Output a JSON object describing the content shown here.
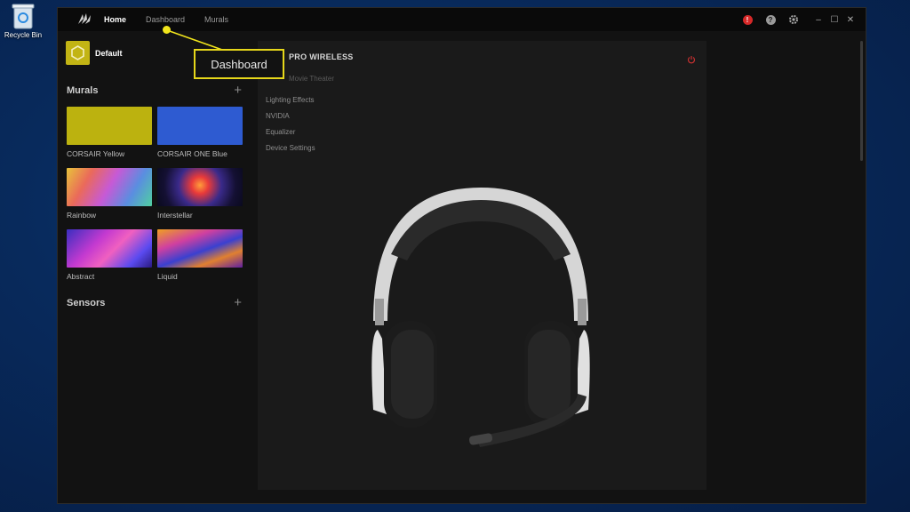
{
  "desktop": {
    "recycle_bin_label": "Recycle Bin"
  },
  "nav": {
    "home": "Home",
    "dashboard": "Dashboard",
    "murals": "Murals"
  },
  "titlebar": {
    "alert_count": "!",
    "help_label": "?",
    "minimize": "–",
    "maximize": "☐",
    "close": "✕"
  },
  "sidebar": {
    "profile_name": "Default",
    "murals_title": "Murals",
    "sensors_title": "Sensors",
    "add_symbol": "+",
    "murals": [
      {
        "label": "CORSAIR Yellow"
      },
      {
        "label": "CORSAIR ONE Blue"
      },
      {
        "label": "Rainbow"
      },
      {
        "label": "Interstellar"
      },
      {
        "label": "Abstract"
      },
      {
        "label": "Liquid"
      }
    ]
  },
  "device": {
    "name": "PRO WIRELESS",
    "preset": "Movie Theater",
    "menu": [
      "Lighting Effects",
      "NVIDIA",
      "Equalizer",
      "Device Settings"
    ]
  },
  "callout": {
    "label": "Dashboard"
  },
  "colors": {
    "accent": "#f1e51c",
    "alert": "#d62828",
    "profile": "#c2b414"
  }
}
